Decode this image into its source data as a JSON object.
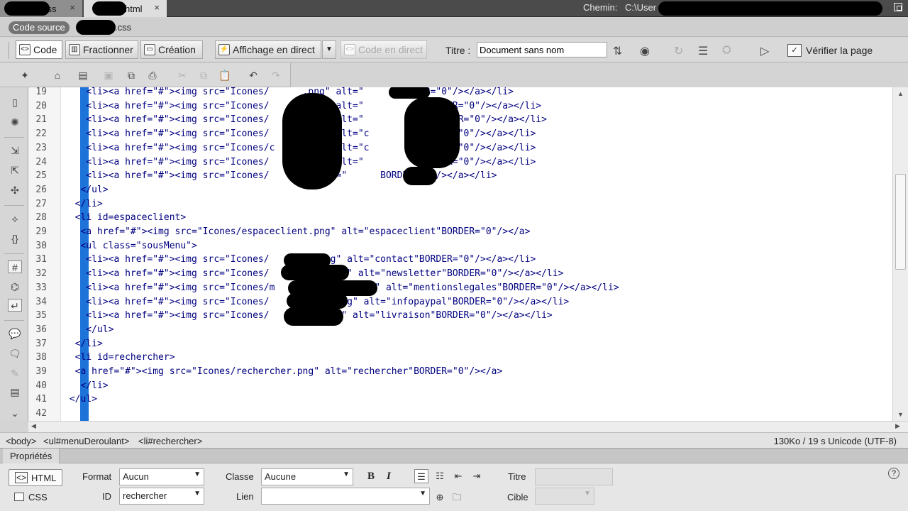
{
  "tabs": [
    {
      "label": "css",
      "close": "×"
    },
    {
      "label": "html",
      "close": "×"
    }
  ],
  "path": {
    "label": "Chemin:",
    "value": "C:\\User"
  },
  "related": {
    "source": "Code source",
    "css": ".css"
  },
  "toolbar": {
    "code": "Code",
    "split": "Fractionner",
    "design": "Création",
    "live_view": "Affichage en direct",
    "live_code": "Code en direct",
    "title_label": "Titre :",
    "title_value": "Document sans nom",
    "check": "Vérifier la page"
  },
  "code_lines": [
    {
      "n": "19",
      "t": "    <li><a href=\"#\"><img src=\"Icones/      .png\" alt=\"      BORDER=\"0\"/></a></li>"
    },
    {
      "n": "20",
      "t": "    <li><a href=\"#\"><img src=\"Icones/      .png\" alt=\"           BORDER=\"0\"/></a></li>"
    },
    {
      "n": "21",
      "t": "    <li><a href=\"#\"><img src=\"Icones/      .png\" alt=\"          e\"BORDER=\"0\"/></a></li>"
    },
    {
      "n": "22",
      "t": "    <li><a href=\"#\"><img src=\"Icones/      .png\" alt=\"c         BORDER=\"0\"/></a></li>"
    },
    {
      "n": "23",
      "t": "    <li><a href=\"#\"><img src=\"Icones/c     .png\" alt=\"c         BORDER=\"0\"/></a></li>"
    },
    {
      "n": "24",
      "t": "    <li><a href=\"#\"><img src=\"Icones/      .png\" alt=\"          BORDER=\"0\"/></a></li>"
    },
    {
      "n": "25",
      "t": "    <li><a href=\"#\"><img src=\"Icones/     ng\" alt=\"      BORDER=\"0\"/></a></li>"
    },
    {
      "n": "26",
      "t": "   </ul>"
    },
    {
      "n": "27",
      "t": "  </li>"
    },
    {
      "n": "28",
      "t": "  <li id=espaceclient>"
    },
    {
      "n": "29",
      "t": "   <a href=\"#\"><img src=\"Icones/espaceclient.png\" alt=\"espaceclient\"BORDER=\"0\"/></a>"
    },
    {
      "n": "30",
      "t": "   <ul class=\"sousMenu\">"
    },
    {
      "n": "31",
      "t": "    <li><a href=\"#\"><img src=\"Icones/        .png\" alt=\"contact\"BORDER=\"0\"/></a></li>"
    },
    {
      "n": "32",
      "t": "    <li><a href=\"#\"><img src=\"Icones/          .png\" alt=\"newsletter\"BORDER=\"0\"/></a></li>"
    },
    {
      "n": "33",
      "t": "    <li><a href=\"#\"><img src=\"Icones/m              .png\" alt=\"mentionslegales\"BORDER=\"0\"/></a></li>"
    },
    {
      "n": "34",
      "t": "    <li><a href=\"#\"><img src=\"Icones/          l.png\" alt=\"infopaypal\"BORDER=\"0\"/></a></li>"
    },
    {
      "n": "35",
      "t": "    <li><a href=\"#\"><img src=\"Icones/          png\" alt=\"livraison\"BORDER=\"0\"/></a></li>"
    },
    {
      "n": "36",
      "t": "    </ul>"
    },
    {
      "n": "37",
      "t": "  </li>"
    },
    {
      "n": "38",
      "t": "  <li id=rechercher>"
    },
    {
      "n": "39",
      "t": "  <a href=\"#\"><img src=\"Icones/rechercher.png\" alt=\"rechercher\"BORDER=\"0\"/></a>"
    },
    {
      "n": "40",
      "t": "   </li>"
    },
    {
      "n": "41",
      "t": " </ul>"
    },
    {
      "n": "42",
      "t": ""
    }
  ],
  "status": {
    "tags": [
      "<body>",
      "<ul#menuDeroulant>",
      "<li#rechercher>"
    ],
    "info": "130Ko / 19 s  Unicode (UTF-8)"
  },
  "properties": {
    "title": "Propriétés",
    "html_mode": "HTML",
    "css_mode": "CSS",
    "format_label": "Format",
    "format_value": "Aucun",
    "id_label": "ID",
    "id_value": "rechercher",
    "class_label": "Classe",
    "class_value": "Aucune",
    "link_label": "Lien",
    "bold": "B",
    "italic": "I",
    "title_label": "Titre",
    "target_label": "Cible",
    "help": "?"
  }
}
